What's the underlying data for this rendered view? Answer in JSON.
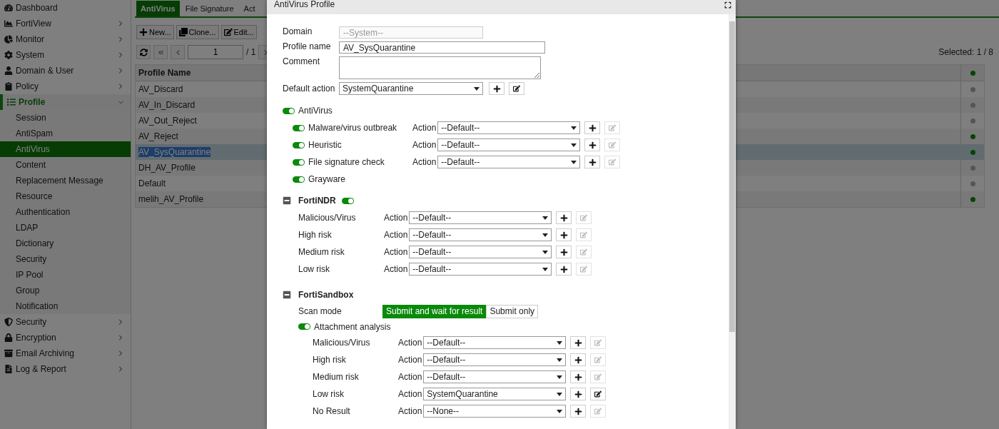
{
  "sidebar": {
    "items": [
      {
        "label": "Dashboard"
      },
      {
        "label": "FortiView",
        "expanded": false
      },
      {
        "label": "Monitor",
        "expanded": false
      },
      {
        "label": "System",
        "expanded": false
      },
      {
        "label": "Domain & User",
        "expanded": false
      },
      {
        "label": "Policy",
        "expanded": false
      },
      {
        "label": "Profile",
        "expanded": true,
        "children": [
          {
            "label": "Session",
            "selected": false
          },
          {
            "label": "AntiSpam",
            "selected": false
          },
          {
            "label": "AntiVirus",
            "selected": true
          },
          {
            "label": "Content",
            "selected": false
          },
          {
            "label": "Replacement Message",
            "selected": false
          },
          {
            "label": "Resource",
            "selected": false
          },
          {
            "label": "Authentication",
            "selected": false
          },
          {
            "label": "LDAP",
            "selected": false
          },
          {
            "label": "Dictionary",
            "selected": false
          },
          {
            "label": "Security",
            "selected": false
          },
          {
            "label": "IP Pool",
            "selected": false
          },
          {
            "label": "Group",
            "selected": false
          },
          {
            "label": "Notification",
            "selected": false
          }
        ]
      },
      {
        "label": "Security",
        "expanded": false
      },
      {
        "label": "Encryption",
        "expanded": false
      },
      {
        "label": "Email Archiving",
        "expanded": false
      },
      {
        "label": "Log & Report",
        "expanded": false
      }
    ]
  },
  "tabs": [
    {
      "label": "AntiVirus",
      "selected": true
    },
    {
      "label": "File Signature",
      "selected": false
    },
    {
      "label": "Act",
      "selected": false
    }
  ],
  "toolbar": [
    "New...",
    "Clone...",
    "Edit..."
  ],
  "pager": {
    "page": "1",
    "total": "/ 1",
    "selection": "Selected: 1 / 8"
  },
  "table": {
    "columns": [
      "Profile Name"
    ],
    "rows": [
      {
        "name": "AV_Discard",
        "selected": false,
        "in_use": false
      },
      {
        "name": "AV_In_Discard",
        "selected": false,
        "in_use": false
      },
      {
        "name": "AV_Out_Reject",
        "selected": false,
        "in_use": false
      },
      {
        "name": "AV_Reject",
        "selected": false,
        "in_use": true
      },
      {
        "name": "AV_SysQuarantine",
        "selected": true,
        "in_use": true
      },
      {
        "name": "DH_AV_Profile",
        "selected": false,
        "in_use": false
      },
      {
        "name": "Default",
        "selected": false,
        "in_use": false
      },
      {
        "name": "melih_AV_Profile",
        "selected": false,
        "in_use": true
      }
    ]
  },
  "dialog": {
    "title": "AntiVirus Profile",
    "fields": [
      {
        "kind": "text",
        "label": "Domain",
        "placeholder": "--System--",
        "disabled": true
      },
      {
        "kind": "text",
        "label": "Profile name",
        "value": "AV_SysQuarantine",
        "disabled": false
      },
      {
        "kind": "textarea",
        "label": "Comment"
      },
      {
        "kind": "select",
        "label": "Default action",
        "value": "SystemQuarantine",
        "edit_enabled": true
      }
    ],
    "antivirus": {
      "label": "AntiVirus",
      "on": true,
      "items": [
        {
          "label": "Malware/virus outbreak",
          "on": true,
          "action_label": "Action",
          "action": "--Default--",
          "edit_enabled": false
        },
        {
          "label": "Heuristic",
          "on": true,
          "action_label": "Action",
          "action": "--Default--",
          "edit_enabled": false
        },
        {
          "label": "File signature check",
          "on": true,
          "action_label": "Action",
          "action": "--Default--",
          "edit_enabled": false
        },
        {
          "label": "Grayware",
          "on": true
        }
      ]
    },
    "fortindr": {
      "label": "FortiNDR",
      "expanded": true,
      "on": true,
      "rows": [
        {
          "label": "Malicious/Virus",
          "action_label": "Action",
          "action": "--Default--",
          "edit_enabled": false
        },
        {
          "label": "High risk",
          "action_label": "Action",
          "action": "--Default--",
          "edit_enabled": false
        },
        {
          "label": "Medium risk",
          "action_label": "Action",
          "action": "--Default--",
          "edit_enabled": false
        },
        {
          "label": "Low risk",
          "action_label": "Action",
          "action": "--Default--",
          "edit_enabled": false
        }
      ]
    },
    "fortisandbox": {
      "label": "FortiSandbox",
      "expanded": true,
      "scan_mode_label": "Scan mode",
      "scan_modes": [
        {
          "label": "Submit and wait for result",
          "selected": true
        },
        {
          "label": "Submit only",
          "selected": false
        }
      ],
      "attachment": {
        "label": "Attachment analysis",
        "on": true
      },
      "rows": [
        {
          "label": "Malicious/Virus",
          "action_label": "Action",
          "action": "--Default--",
          "edit_enabled": false
        },
        {
          "label": "High risk",
          "action_label": "Action",
          "action": "--Default--",
          "edit_enabled": false
        },
        {
          "label": "Medium risk",
          "action_label": "Action",
          "action": "--Default--",
          "edit_enabled": false
        },
        {
          "label": "Low risk",
          "action_label": "Action",
          "action": "SystemQuarantine",
          "edit_enabled": true
        },
        {
          "label": "No Result",
          "action_label": "Action",
          "action": "--None--",
          "edit_enabled": false
        }
      ]
    }
  }
}
